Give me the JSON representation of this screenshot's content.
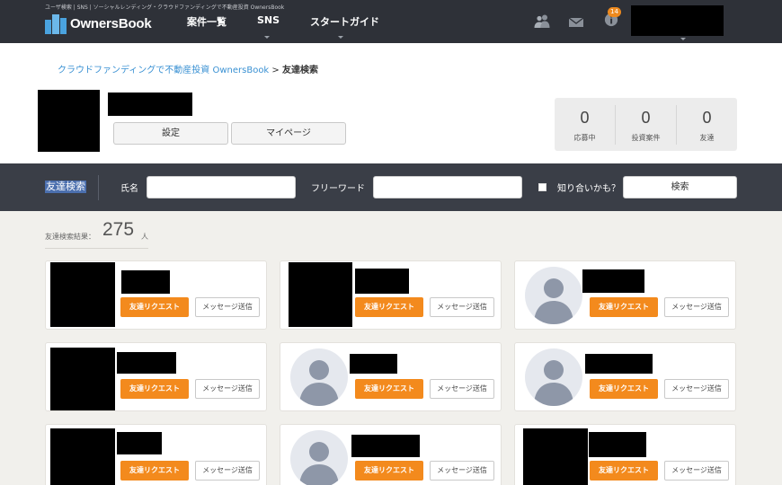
{
  "header": {
    "tagline": "ユーザ検索 | SNS | ソーシャルレンディング・クラウドファンディングで不動産投資 OwnersBook",
    "logo_text": "OwnersBook",
    "nav": [
      "案件一覧",
      "SNS",
      "スタートガイド"
    ],
    "notification_count": "14",
    "icons": [
      "friends-icon",
      "mail-icon",
      "info-icon"
    ]
  },
  "breadcrumb": {
    "home": "クラウドファンディングで不動産投資 OwnersBook",
    "separator": ">",
    "current": "友達検索"
  },
  "profile": {
    "settings_label": "設定",
    "mypage_label": "マイページ",
    "stats": [
      {
        "value": "0",
        "label": "応募中"
      },
      {
        "value": "0",
        "label": "投資案件"
      },
      {
        "value": "0",
        "label": "友達"
      }
    ]
  },
  "search": {
    "title": "友達検索",
    "name_label": "氏名",
    "name_value": "",
    "freeword_label": "フリーワード",
    "freeword_value": "",
    "maybe_label": "知り合いかも？",
    "maybe_checked": false,
    "button_label": "検索"
  },
  "results": {
    "label": "友達検索結果：",
    "count": "275",
    "unit": "人",
    "request_label": "友達リクエスト",
    "message_label": "メッセージ送信",
    "cards": [
      {
        "avatar": "photo"
      },
      {
        "avatar": "photo"
      },
      {
        "avatar": "default"
      },
      {
        "avatar": "photo"
      },
      {
        "avatar": "default"
      },
      {
        "avatar": "default"
      },
      {
        "avatar": "photo"
      },
      {
        "avatar": "default"
      },
      {
        "avatar": "photo"
      }
    ]
  },
  "colors": {
    "header_bg": "#2e3138",
    "accent_orange": "#f38a1d",
    "link_blue": "#3a91d3",
    "search_bar_bg": "#3a3e47",
    "page_bg": "#f1f0ec"
  }
}
